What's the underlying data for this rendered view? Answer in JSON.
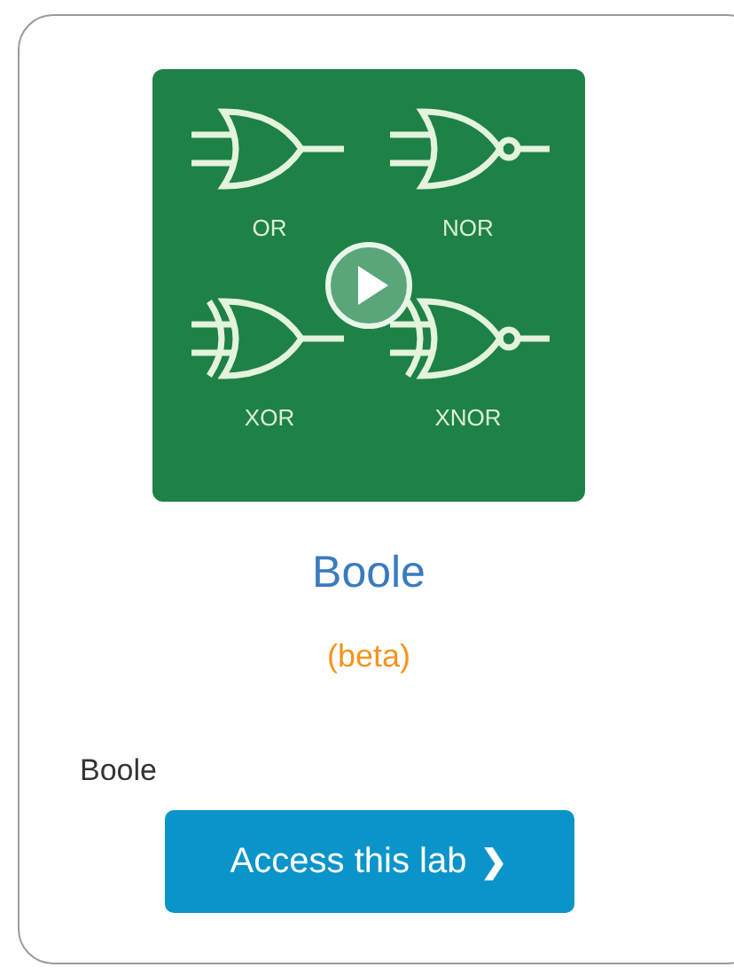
{
  "lab": {
    "thumbnail": {
      "gates": [
        {
          "kind": "or",
          "label": "OR"
        },
        {
          "kind": "nor",
          "label": "NOR"
        },
        {
          "kind": "xor",
          "label": "XOR"
        },
        {
          "kind": "xnor",
          "label": "XNOR"
        }
      ]
    },
    "title": "Boole",
    "badge": "(beta)",
    "description": "Boole",
    "button": {
      "label": "Access this lab",
      "icon": "❯"
    }
  }
}
